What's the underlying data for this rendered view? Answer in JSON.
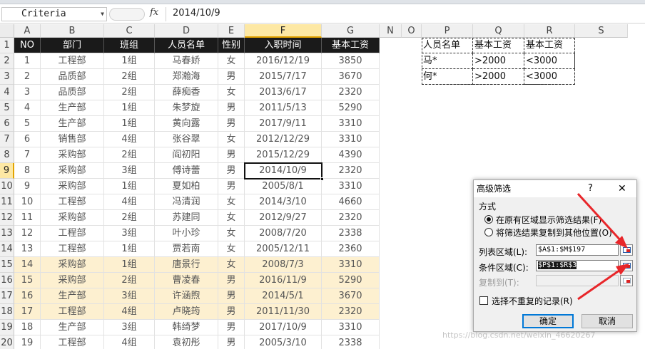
{
  "formula_bar": {
    "name_box": "Criteria",
    "fx_symbol": "fx",
    "formula": "2014/10/9"
  },
  "columns": [
    "A",
    "B",
    "C",
    "D",
    "E",
    "F",
    "G",
    "N",
    "O",
    "P",
    "Q",
    "R",
    "S"
  ],
  "rows": [
    "1",
    "2",
    "3",
    "4",
    "5",
    "6",
    "7",
    "8",
    "9",
    "10",
    "11",
    "12",
    "13",
    "14",
    "15",
    "16",
    "17",
    "18",
    "19",
    "20"
  ],
  "table": {
    "headers": [
      "NO",
      "部门",
      "班组",
      "人员名单",
      "性别",
      "入职时间",
      "基本工资"
    ],
    "rows": [
      [
        "1",
        "工程部",
        "1组",
        "马春娇",
        "女",
        "2016/12/19",
        "3850"
      ],
      [
        "2",
        "品质部",
        "2组",
        "郑瀚海",
        "男",
        "2015/7/17",
        "3670"
      ],
      [
        "3",
        "品质部",
        "2组",
        "薛痴香",
        "女",
        "2013/6/17",
        "2320"
      ],
      [
        "4",
        "生产部",
        "1组",
        "朱梦旋",
        "男",
        "2011/5/13",
        "5290"
      ],
      [
        "5",
        "生产部",
        "1组",
        "黄向露",
        "男",
        "2017/9/11",
        "3310"
      ],
      [
        "6",
        "销售部",
        "4组",
        "张谷翠",
        "女",
        "2012/12/29",
        "3310"
      ],
      [
        "7",
        "采购部",
        "2组",
        "阎初阳",
        "男",
        "2015/12/29",
        "4390"
      ],
      [
        "8",
        "采购部",
        "3组",
        "傅诗蕾",
        "男",
        "2014/10/9",
        "2320"
      ],
      [
        "9",
        "采购部",
        "1组",
        "夏如柏",
        "男",
        "2005/8/1",
        "3310"
      ],
      [
        "10",
        "工程部",
        "4组",
        "冯清润",
        "女",
        "2014/3/10",
        "4660"
      ],
      [
        "11",
        "采购部",
        "2组",
        "苏建同",
        "女",
        "2012/9/27",
        "2320"
      ],
      [
        "12",
        "工程部",
        "3组",
        "叶小珍",
        "女",
        "2008/7/20",
        "2338"
      ],
      [
        "13",
        "工程部",
        "1组",
        "贾若南",
        "女",
        "2005/12/11",
        "2360"
      ],
      [
        "14",
        "采购部",
        "1组",
        "唐景行",
        "女",
        "2008/7/3",
        "3310"
      ],
      [
        "15",
        "采购部",
        "2组",
        "曹凌春",
        "男",
        "2016/11/9",
        "5290"
      ],
      [
        "16",
        "生产部",
        "3组",
        "许涵煦",
        "男",
        "2014/5/1",
        "3670"
      ],
      [
        "17",
        "工程部",
        "4组",
        "卢晓筠",
        "男",
        "2011/11/30",
        "2320"
      ],
      [
        "18",
        "生产部",
        "3组",
        "韩绮梦",
        "男",
        "2017/10/9",
        "3310"
      ],
      [
        "19",
        "工程部",
        "4组",
        "袁初彤",
        "男",
        "2005/3/10",
        "2338"
      ]
    ]
  },
  "criteria": {
    "headers": [
      "人员名单",
      "基本工资",
      "基本工资"
    ],
    "rows": [
      [
        "马*",
        ">2000",
        "<3000"
      ],
      [
        "何*",
        ">2000",
        "<3000"
      ]
    ]
  },
  "dialog": {
    "title": "高级筛选",
    "help": "?",
    "close": "✕",
    "mode_label": "方式",
    "option_inplace": "在原有区域显示筛选结果(F)",
    "option_copy": "将筛选结果复制到其他位置(O)",
    "list_range_label": "列表区域(L):",
    "list_range_value": "$A$1:$M$197",
    "criteria_range_label": "条件区域(C):",
    "criteria_range_value": "$P$1:$R$3",
    "copy_to_label": "复制到(T):",
    "copy_to_value": "",
    "unique_label": "选择不重复的记录(R)",
    "ok_label": "确定",
    "cancel_label": "取消"
  },
  "watermark": "https://blog.csdn.net/weixin_46620267",
  "colors": {
    "header_bg": "#1a1a1a",
    "highlight_row": "#fdf0d0",
    "selected_hdr": "#fde8a4",
    "arrow": "#e8262a"
  }
}
